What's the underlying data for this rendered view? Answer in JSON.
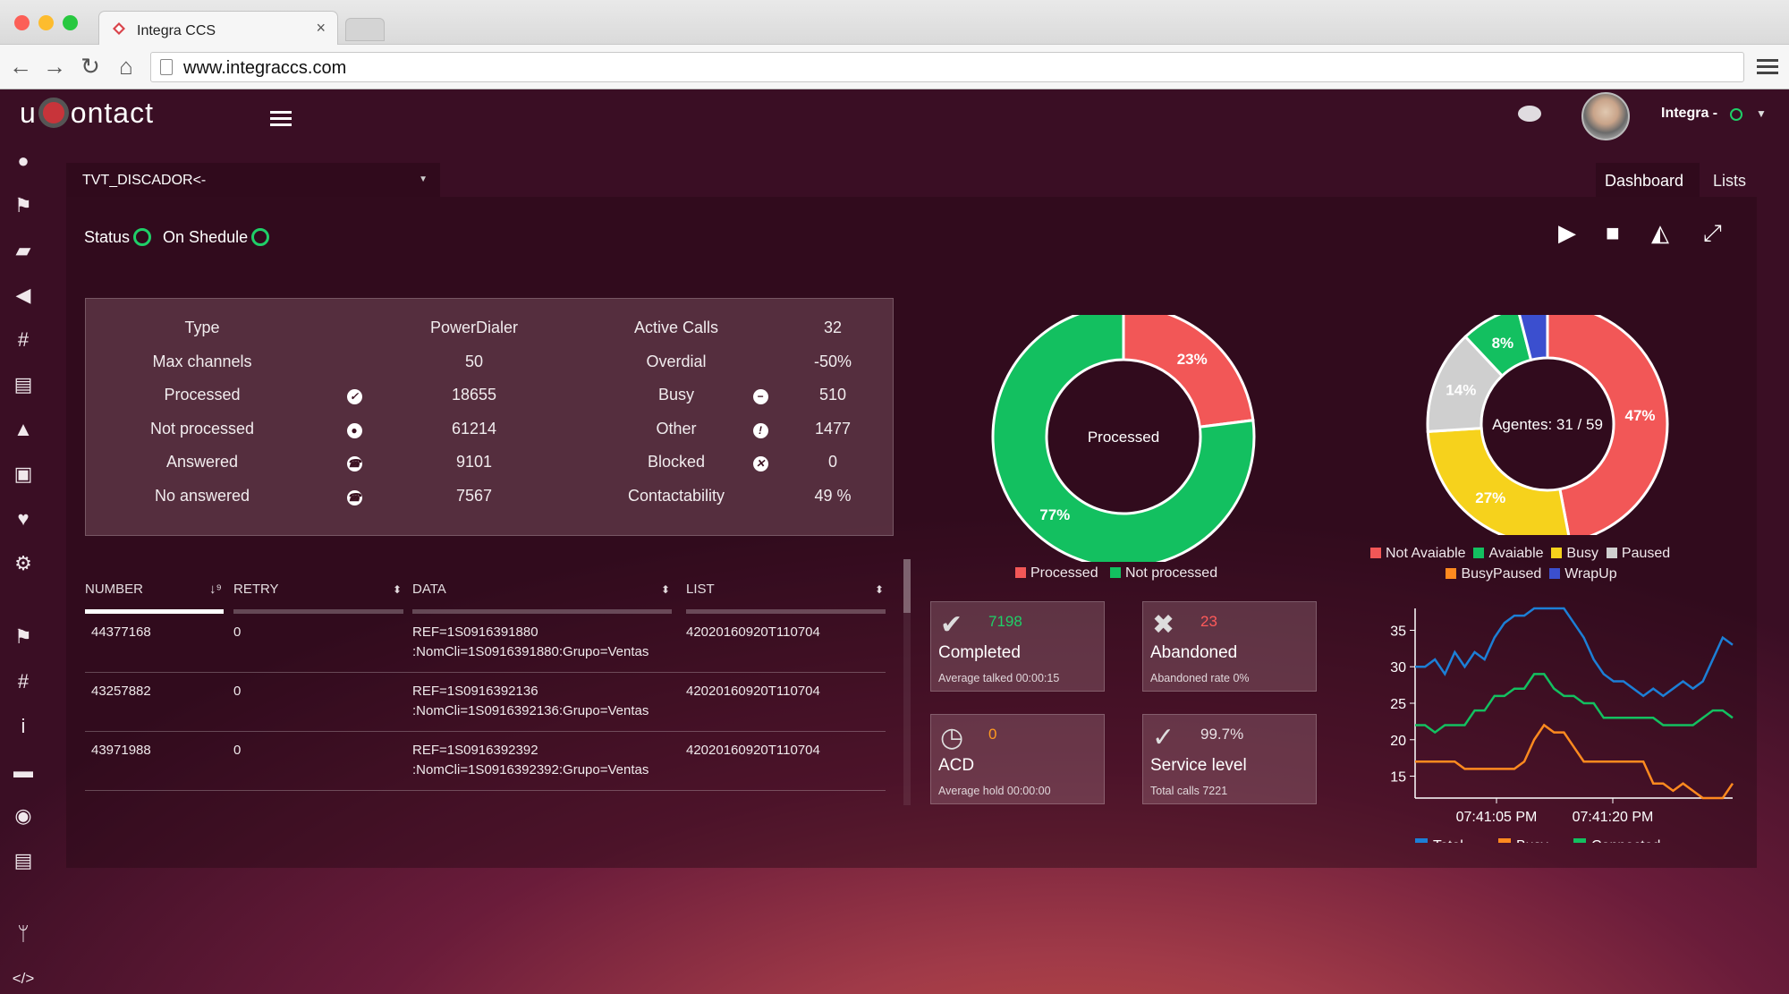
{
  "browser": {
    "tab_title": "Integra CCS",
    "url": "www.integraccs.com"
  },
  "app": {
    "logo_text_u": "u",
    "logo_text_rest": "ontact",
    "user": "Integra -"
  },
  "campaign": {
    "name": "TVT_DISCADOR<-",
    "status_label": "Status",
    "schedule_label": "On Shedule"
  },
  "tabs": {
    "dashboard": "Dashboard",
    "lists": "Lists"
  },
  "stats": [
    {
      "l1": "Type",
      "v1": "PowerDialer",
      "l2": "Active Calls",
      "v2": "32",
      "i1": "",
      "i2": ""
    },
    {
      "l1": "Max channels",
      "v1": "50",
      "l2": "Overdial",
      "v2": "-50%",
      "i1": "",
      "i2": ""
    },
    {
      "l1": "Processed",
      "v1": "18655",
      "l2": "Busy",
      "v2": "510",
      "i1": "✓",
      "i2": "−"
    },
    {
      "l1": "Not processed",
      "v1": "61214",
      "l2": "Other",
      "v2": "1477",
      "i1": "●",
      "i2": "!"
    },
    {
      "l1": "Answered",
      "v1": "9101",
      "l2": "Blocked",
      "v2": "0",
      "i1": "☎",
      "i2": "✕"
    },
    {
      "l1": "No answered",
      "v1": "7567",
      "l2": "Contactability",
      "v2": "49 %",
      "i1": "☎",
      "i2": ""
    }
  ],
  "table": {
    "headers": [
      "NUMBER",
      "RETRY",
      "DATA",
      "LIST"
    ],
    "rows": [
      {
        "number": "44377168",
        "retry": "0",
        "data1": "REF=1S0916391880",
        "data2": ":NomCli=1S0916391880:Grupo=Ventas",
        "list": "42020160920T110704"
      },
      {
        "number": "43257882",
        "retry": "0",
        "data1": "REF=1S0916392136",
        "data2": ":NomCli=1S0916392136:Grupo=Ventas",
        "list": "42020160920T110704"
      },
      {
        "number": "43971988",
        "retry": "0",
        "data1": "REF=1S0916392392",
        "data2": ":NomCli=1S0916392392:Grupo=Ventas",
        "list": "42020160920T110704"
      }
    ]
  },
  "kpis": {
    "completed": {
      "value": "7198",
      "title": "Completed",
      "sub": "Average talked 00:00:15",
      "color": "#1fcf68"
    },
    "abandoned": {
      "value": "23",
      "title": "Abandoned",
      "sub": "Abandoned rate 0%",
      "color": "#ff5a5a"
    },
    "acd": {
      "value": "0",
      "title": "ACD",
      "sub": "Average hold 00:00:00",
      "color": "#ff9a1f"
    },
    "service": {
      "value": "99.7%",
      "title": "Service level",
      "sub": "Total calls 7221",
      "color": "#e8e0e4"
    }
  },
  "chart_data": [
    {
      "type": "pie",
      "title": "",
      "center_label": "Processed",
      "labels": [
        "Processed",
        "Not processed"
      ],
      "values": [
        23,
        77
      ],
      "colors": [
        "#f25757",
        "#13c060"
      ]
    },
    {
      "type": "pie",
      "title": "",
      "center_label": "Agentes: 31 / 59",
      "labels": [
        "Not Avaiable",
        "Avaiable",
        "Busy",
        "Paused",
        "BusyPaused",
        "WrapUp"
      ],
      "values": [
        47,
        8,
        27,
        14,
        0,
        4
      ],
      "colors": [
        "#f25757",
        "#13c060",
        "#f6d21c",
        "#cfcfcf",
        "#ff8a1f",
        "#3b4fcf"
      ],
      "slice_labels": [
        "47%",
        "8%",
        "27%",
        "14%",
        "",
        ""
      ]
    },
    {
      "type": "line",
      "title": "",
      "xlabel": "",
      "ylabel": "",
      "ylim": [
        12,
        38
      ],
      "x_ticks": [
        "07:41:05 PM",
        "07:41:20 PM"
      ],
      "y_ticks": [
        15,
        20,
        25,
        30,
        35
      ],
      "series": [
        {
          "name": "Total",
          "color": "#1c7fd6",
          "values": [
            30,
            30,
            31,
            29,
            32,
            30,
            32,
            31,
            34,
            36,
            37,
            37,
            38,
            38,
            38,
            38,
            36,
            34,
            31,
            29,
            28,
            28,
            27,
            26,
            27,
            26,
            27,
            28,
            27,
            28,
            31,
            34,
            33
          ]
        },
        {
          "name": "Busy",
          "color": "#ff8a1f",
          "values": [
            17,
            17,
            17,
            17,
            17,
            16,
            16,
            16,
            16,
            16,
            16,
            17,
            20,
            22,
            21,
            21,
            19,
            17,
            17,
            17,
            17,
            17,
            17,
            17,
            14,
            14,
            13,
            14,
            13,
            12,
            12,
            12,
            14
          ]
        },
        {
          "name": "Connected",
          "color": "#13c060",
          "values": [
            22,
            22,
            21,
            22,
            22,
            22,
            24,
            24,
            26,
            26,
            27,
            27,
            29,
            29,
            27,
            26,
            26,
            25,
            25,
            23,
            23,
            23,
            23,
            23,
            23,
            22,
            22,
            22,
            22,
            23,
            24,
            24,
            23
          ]
        }
      ]
    }
  ]
}
